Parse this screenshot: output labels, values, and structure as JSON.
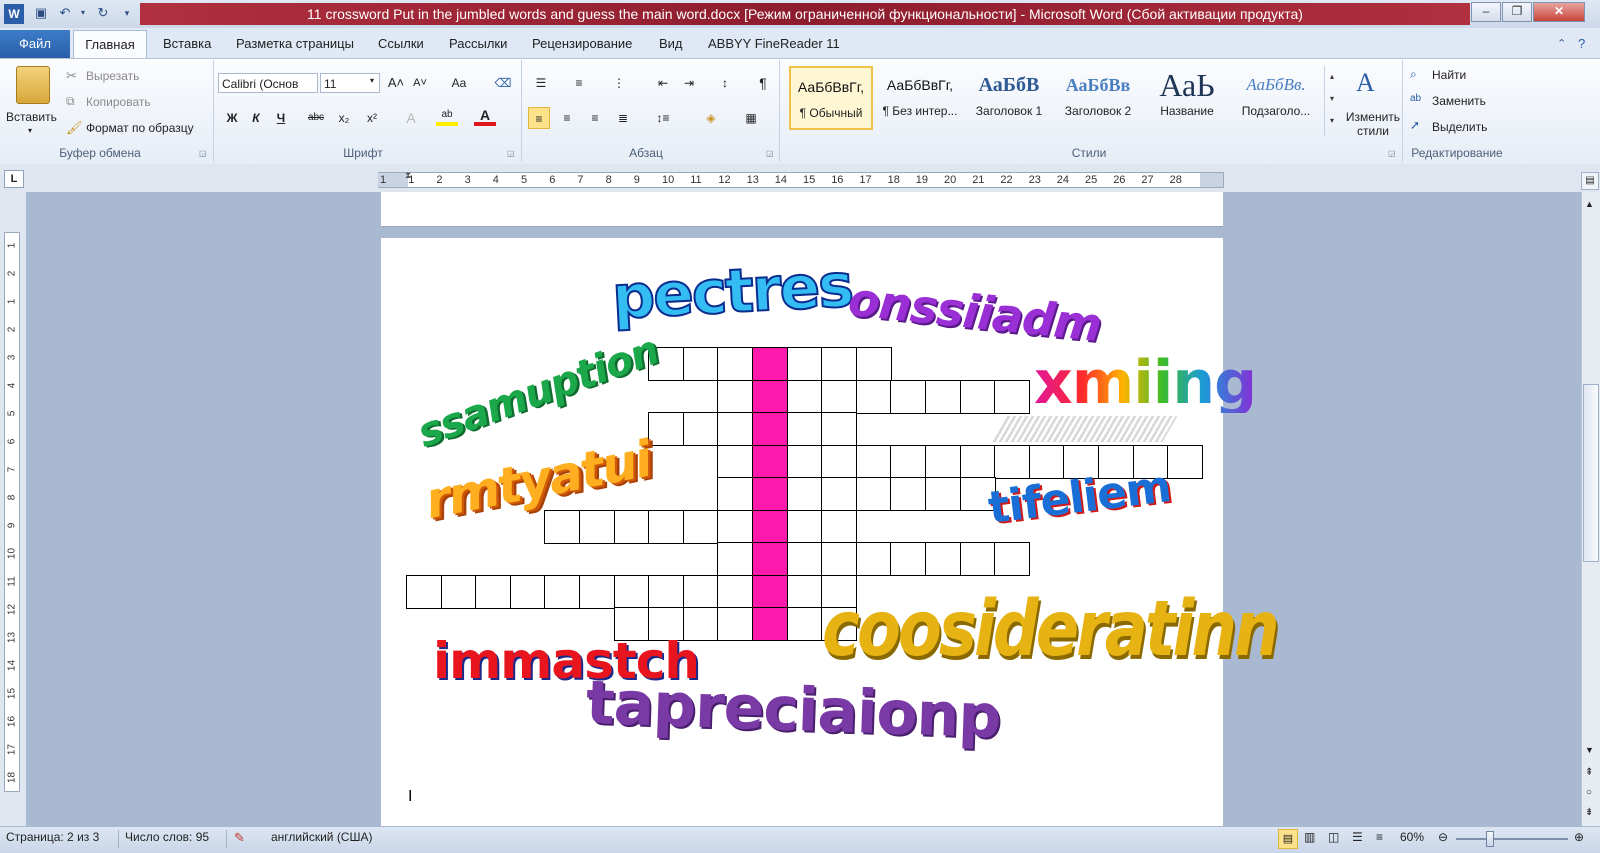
{
  "titlebar": {
    "title": "11 crossword Put in the jumbled words and guess the main word.docx [Режим ограниченной функциональности] - Microsoft Word (Сбой активации продукта)",
    "icons": [
      "word-logo-icon",
      "save-icon",
      "undo-icon",
      "redo-icon",
      "customize-qat-icon"
    ],
    "controls": [
      "minimize",
      "maximize",
      "close"
    ]
  },
  "tabs": {
    "file": "Файл",
    "items": [
      "Главная",
      "Вставка",
      "Разметка страницы",
      "Ссылки",
      "Рассылки",
      "Рецензирование",
      "Вид",
      "ABBYY FineReader 11"
    ]
  },
  "clipboard": {
    "paste": "Вставить",
    "cut": "Вырезать",
    "copy": "Копировать",
    "format_painter": "Формат по образцу",
    "group_name": "Буфер обмена"
  },
  "font": {
    "font_name": "Calibri (Основ",
    "font_size": "11",
    "bold": "Ж",
    "italic": "К",
    "underline": "Ч",
    "strike": "abc",
    "subscript": "x₂",
    "superscript": "x²",
    "group_name": "Шрифт"
  },
  "paragraph": {
    "group_name": "Абзац"
  },
  "styles": {
    "items": [
      {
        "sample": "АаБбВвГг,",
        "label": "¶ Обычный"
      },
      {
        "sample": "АаБбВвГг,",
        "label": "¶ Без интер..."
      },
      {
        "sample": "АаБбВ",
        "label": "Заголовок 1"
      },
      {
        "sample": "АаБбВв",
        "label": "Заголовок 2"
      },
      {
        "sample": "АаЬ",
        "label": "Название"
      },
      {
        "sample": "АаБбВв.",
        "label": "Подзаголо..."
      }
    ],
    "change_styles": "Изменить стили",
    "group_name": "Стили"
  },
  "editing": {
    "find": "Найти",
    "replace": "Заменить",
    "select": "Выделить",
    "group_name": "Редактирование"
  },
  "ruler": {
    "numbers": [
      "1",
      "1",
      "2",
      "3",
      "4",
      "5",
      "6",
      "7",
      "8",
      "9",
      "10",
      "11",
      "12",
      "13",
      "14",
      "15",
      "16",
      "17",
      "18",
      "19",
      "20",
      "21",
      "22",
      "23",
      "24",
      "25",
      "26",
      "27",
      "28"
    ],
    "vnumbers": [
      "1",
      "2",
      "1",
      "2",
      "3",
      "4",
      "5",
      "6",
      "7",
      "8",
      "9",
      "10",
      "11",
      "12",
      "13",
      "14",
      "15",
      "16",
      "17",
      "18"
    ]
  },
  "document": {
    "wordart": [
      {
        "text": "pectres",
        "color": "#33bdf2"
      },
      {
        "text": "onssiiadm",
        "color": "#9a2fd6"
      },
      {
        "text": "ssamuption",
        "color": "#1aa84a"
      },
      {
        "text": "xmiing",
        "color": "#d01fa0"
      },
      {
        "text": "rmtyatui",
        "color": "#f07a10"
      },
      {
        "text": "tifeliem",
        "color": "#1a6fd6"
      },
      {
        "text": "immastch",
        "color": "#e8141e"
      },
      {
        "text": "coosideratinn",
        "color": "#e6b312"
      },
      {
        "text": "tapreciaionp",
        "color": "#7a3aa6"
      }
    ],
    "cursor": "I",
    "highlight_color": "#ff1aae"
  },
  "status": {
    "page": "Страница: 2 из 3",
    "words": "Число слов: 95",
    "language": "английский (США)",
    "zoom": "60%"
  }
}
